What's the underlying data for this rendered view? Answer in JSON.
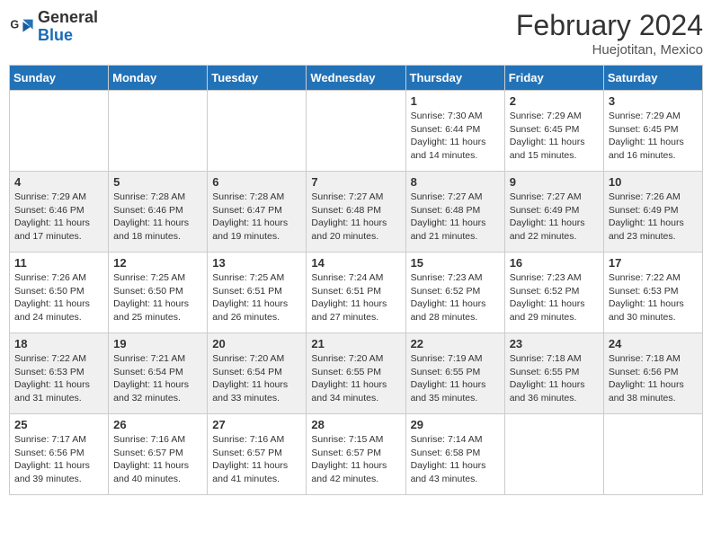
{
  "header": {
    "logo_general": "General",
    "logo_blue": "Blue",
    "title": "February 2024",
    "subtitle": "Huejotitan, Mexico"
  },
  "days_of_week": [
    "Sunday",
    "Monday",
    "Tuesday",
    "Wednesday",
    "Thursday",
    "Friday",
    "Saturday"
  ],
  "weeks": [
    [
      {
        "day": "",
        "info": ""
      },
      {
        "day": "",
        "info": ""
      },
      {
        "day": "",
        "info": ""
      },
      {
        "day": "",
        "info": ""
      },
      {
        "day": "1",
        "info": "Sunrise: 7:30 AM\nSunset: 6:44 PM\nDaylight: 11 hours and 14 minutes."
      },
      {
        "day": "2",
        "info": "Sunrise: 7:29 AM\nSunset: 6:45 PM\nDaylight: 11 hours and 15 minutes."
      },
      {
        "day": "3",
        "info": "Sunrise: 7:29 AM\nSunset: 6:45 PM\nDaylight: 11 hours and 16 minutes."
      }
    ],
    [
      {
        "day": "4",
        "info": "Sunrise: 7:29 AM\nSunset: 6:46 PM\nDaylight: 11 hours and 17 minutes."
      },
      {
        "day": "5",
        "info": "Sunrise: 7:28 AM\nSunset: 6:46 PM\nDaylight: 11 hours and 18 minutes."
      },
      {
        "day": "6",
        "info": "Sunrise: 7:28 AM\nSunset: 6:47 PM\nDaylight: 11 hours and 19 minutes."
      },
      {
        "day": "7",
        "info": "Sunrise: 7:27 AM\nSunset: 6:48 PM\nDaylight: 11 hours and 20 minutes."
      },
      {
        "day": "8",
        "info": "Sunrise: 7:27 AM\nSunset: 6:48 PM\nDaylight: 11 hours and 21 minutes."
      },
      {
        "day": "9",
        "info": "Sunrise: 7:27 AM\nSunset: 6:49 PM\nDaylight: 11 hours and 22 minutes."
      },
      {
        "day": "10",
        "info": "Sunrise: 7:26 AM\nSunset: 6:49 PM\nDaylight: 11 hours and 23 minutes."
      }
    ],
    [
      {
        "day": "11",
        "info": "Sunrise: 7:26 AM\nSunset: 6:50 PM\nDaylight: 11 hours and 24 minutes."
      },
      {
        "day": "12",
        "info": "Sunrise: 7:25 AM\nSunset: 6:50 PM\nDaylight: 11 hours and 25 minutes."
      },
      {
        "day": "13",
        "info": "Sunrise: 7:25 AM\nSunset: 6:51 PM\nDaylight: 11 hours and 26 minutes."
      },
      {
        "day": "14",
        "info": "Sunrise: 7:24 AM\nSunset: 6:51 PM\nDaylight: 11 hours and 27 minutes."
      },
      {
        "day": "15",
        "info": "Sunrise: 7:23 AM\nSunset: 6:52 PM\nDaylight: 11 hours and 28 minutes."
      },
      {
        "day": "16",
        "info": "Sunrise: 7:23 AM\nSunset: 6:52 PM\nDaylight: 11 hours and 29 minutes."
      },
      {
        "day": "17",
        "info": "Sunrise: 7:22 AM\nSunset: 6:53 PM\nDaylight: 11 hours and 30 minutes."
      }
    ],
    [
      {
        "day": "18",
        "info": "Sunrise: 7:22 AM\nSunset: 6:53 PM\nDaylight: 11 hours and 31 minutes."
      },
      {
        "day": "19",
        "info": "Sunrise: 7:21 AM\nSunset: 6:54 PM\nDaylight: 11 hours and 32 minutes."
      },
      {
        "day": "20",
        "info": "Sunrise: 7:20 AM\nSunset: 6:54 PM\nDaylight: 11 hours and 33 minutes."
      },
      {
        "day": "21",
        "info": "Sunrise: 7:20 AM\nSunset: 6:55 PM\nDaylight: 11 hours and 34 minutes."
      },
      {
        "day": "22",
        "info": "Sunrise: 7:19 AM\nSunset: 6:55 PM\nDaylight: 11 hours and 35 minutes."
      },
      {
        "day": "23",
        "info": "Sunrise: 7:18 AM\nSunset: 6:55 PM\nDaylight: 11 hours and 36 minutes."
      },
      {
        "day": "24",
        "info": "Sunrise: 7:18 AM\nSunset: 6:56 PM\nDaylight: 11 hours and 38 minutes."
      }
    ],
    [
      {
        "day": "25",
        "info": "Sunrise: 7:17 AM\nSunset: 6:56 PM\nDaylight: 11 hours and 39 minutes."
      },
      {
        "day": "26",
        "info": "Sunrise: 7:16 AM\nSunset: 6:57 PM\nDaylight: 11 hours and 40 minutes."
      },
      {
        "day": "27",
        "info": "Sunrise: 7:16 AM\nSunset: 6:57 PM\nDaylight: 11 hours and 41 minutes."
      },
      {
        "day": "28",
        "info": "Sunrise: 7:15 AM\nSunset: 6:57 PM\nDaylight: 11 hours and 42 minutes."
      },
      {
        "day": "29",
        "info": "Sunrise: 7:14 AM\nSunset: 6:58 PM\nDaylight: 11 hours and 43 minutes."
      },
      {
        "day": "",
        "info": ""
      },
      {
        "day": "",
        "info": ""
      }
    ]
  ]
}
